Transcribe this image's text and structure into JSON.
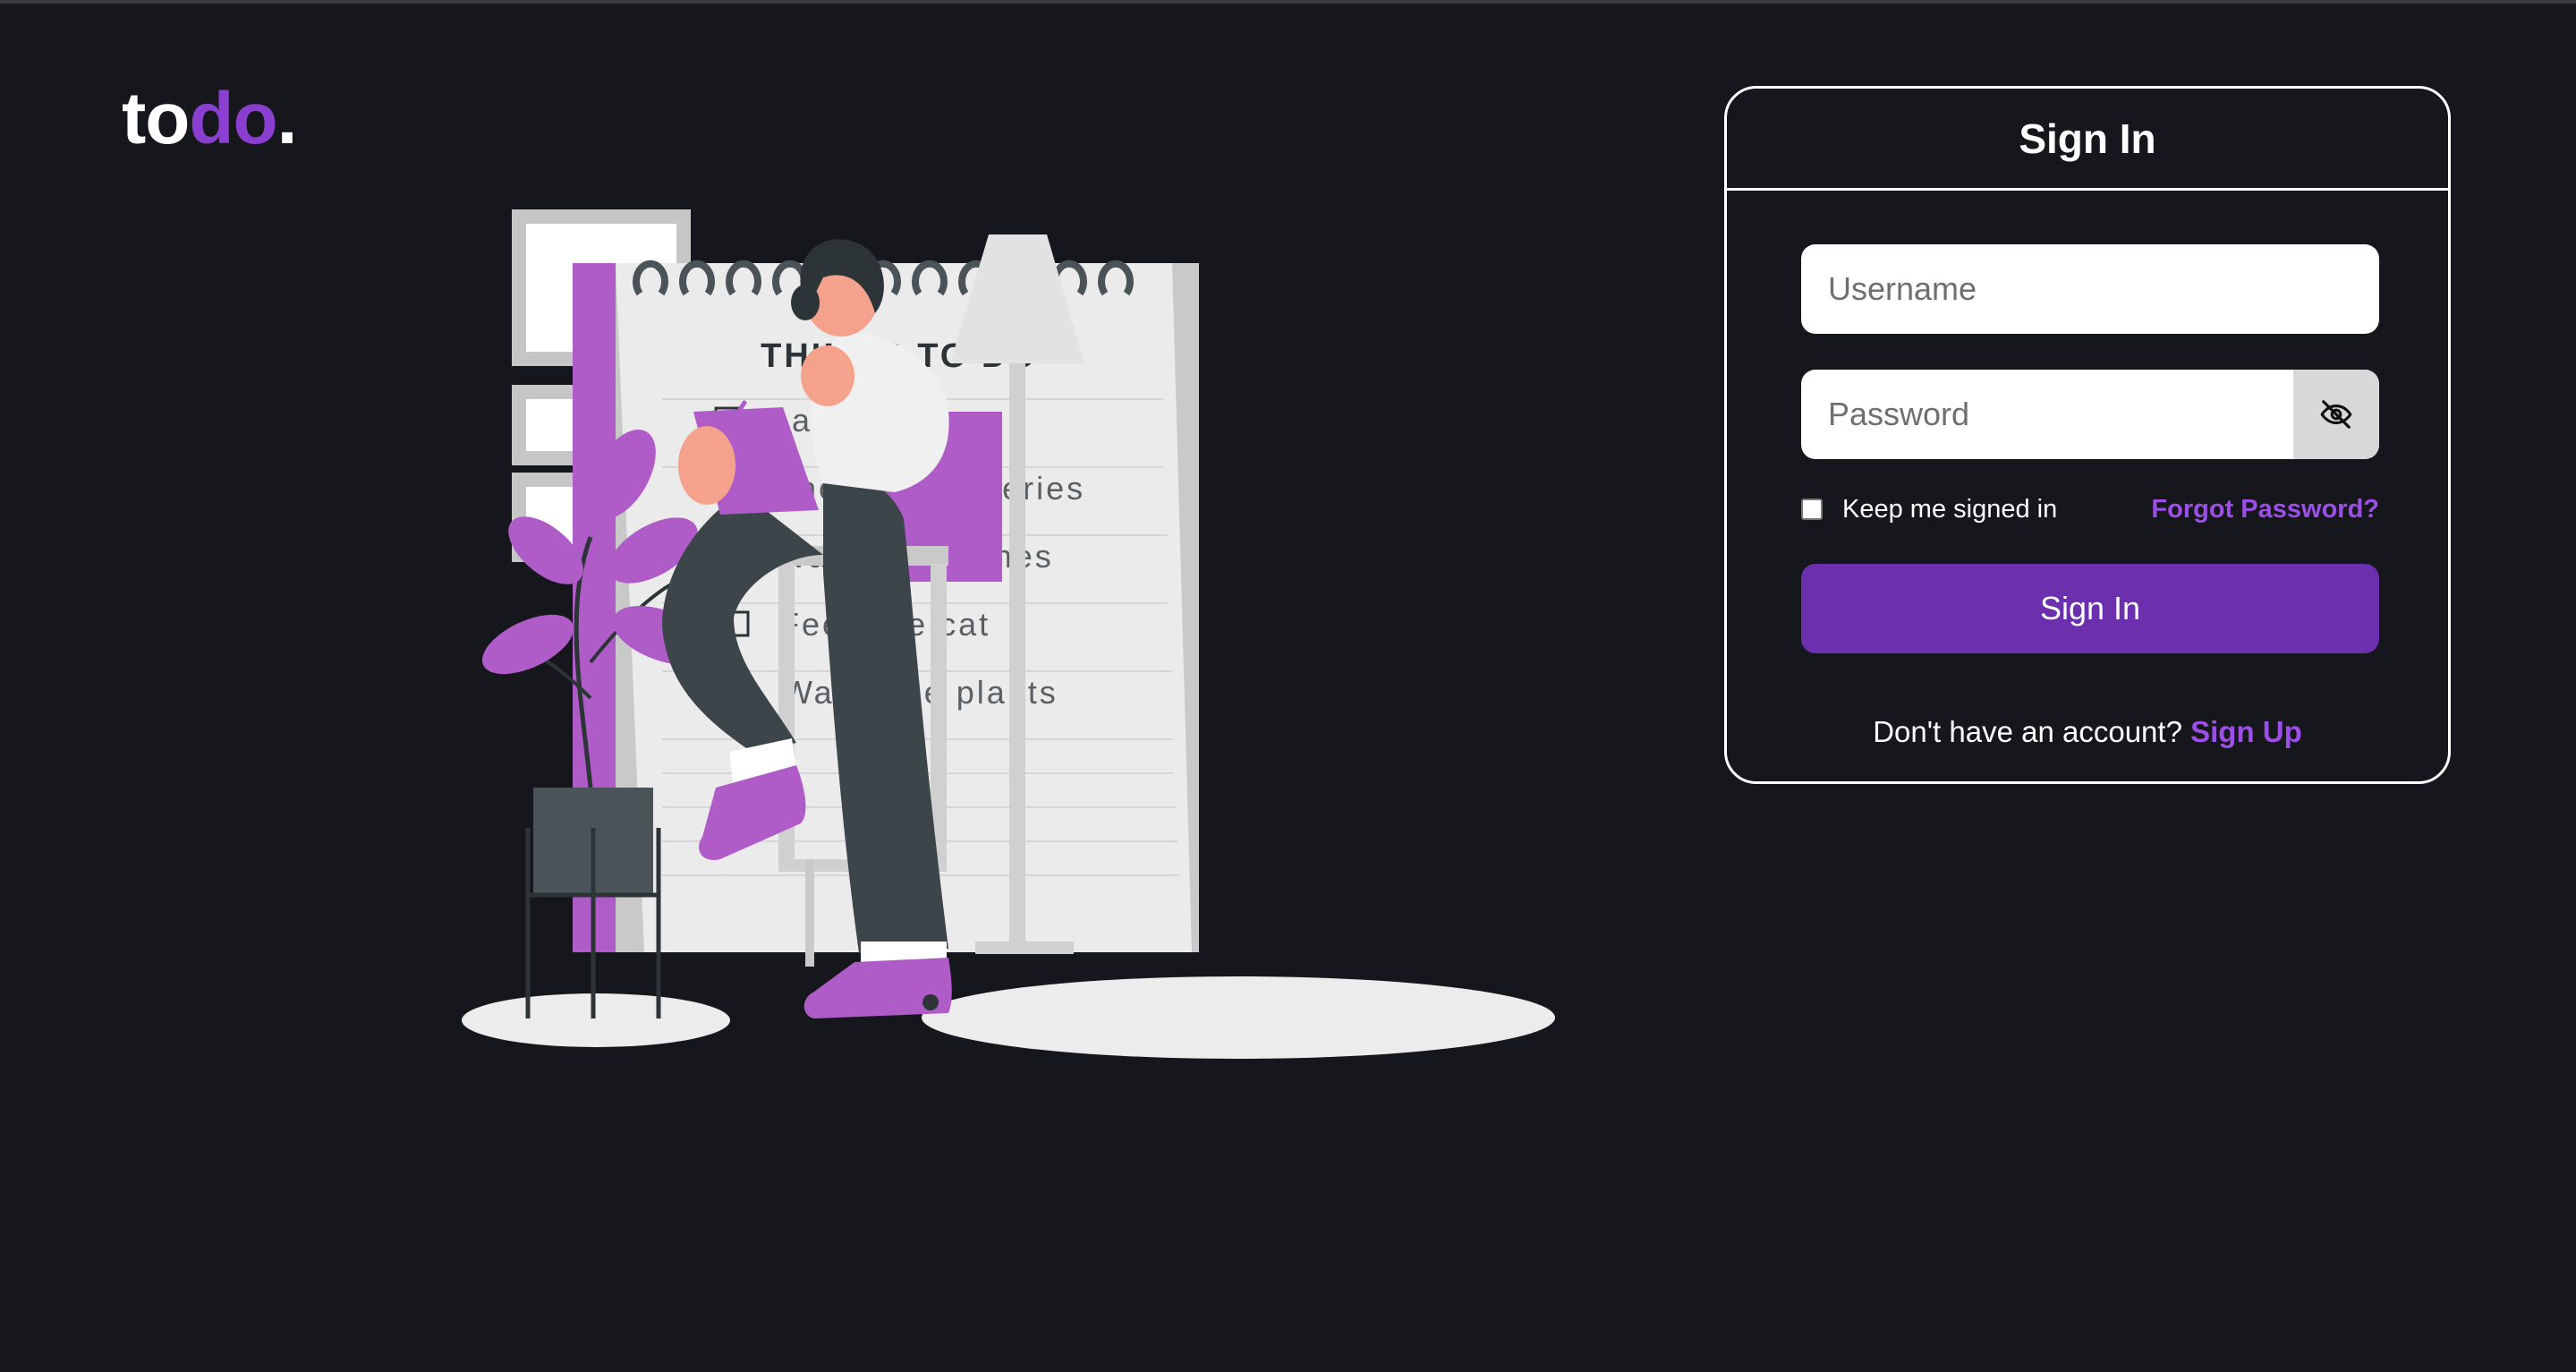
{
  "logo": {
    "part1": "to",
    "part2": "do",
    "part3": "."
  },
  "illustration": {
    "heading": "THINGS TO DO",
    "tasks": [
      {
        "label": "Laundry",
        "done": true
      },
      {
        "label": "Shop for groceries",
        "done": true
      },
      {
        "label": "Wash the dishes",
        "done": true
      },
      {
        "label": "Feed the cat",
        "done": false
      },
      {
        "label": "Water the plants",
        "done": false
      }
    ]
  },
  "signin": {
    "title": "Sign In",
    "username_placeholder": "Username",
    "username_value": "",
    "password_placeholder": "Password",
    "password_value": "",
    "password_toggle_icon": "eye-off-icon",
    "keep_signed_in_label": "Keep me signed in",
    "keep_signed_in_checked": false,
    "forgot_label": "Forgot Password?",
    "submit_label": "Sign In",
    "no_account_text": "Don't have an account?",
    "signup_label": "Sign Up"
  },
  "colors": {
    "background": "#16171c",
    "accent": "#8b3fd1",
    "button": "#6c2fad",
    "link": "#9b4fe6"
  }
}
